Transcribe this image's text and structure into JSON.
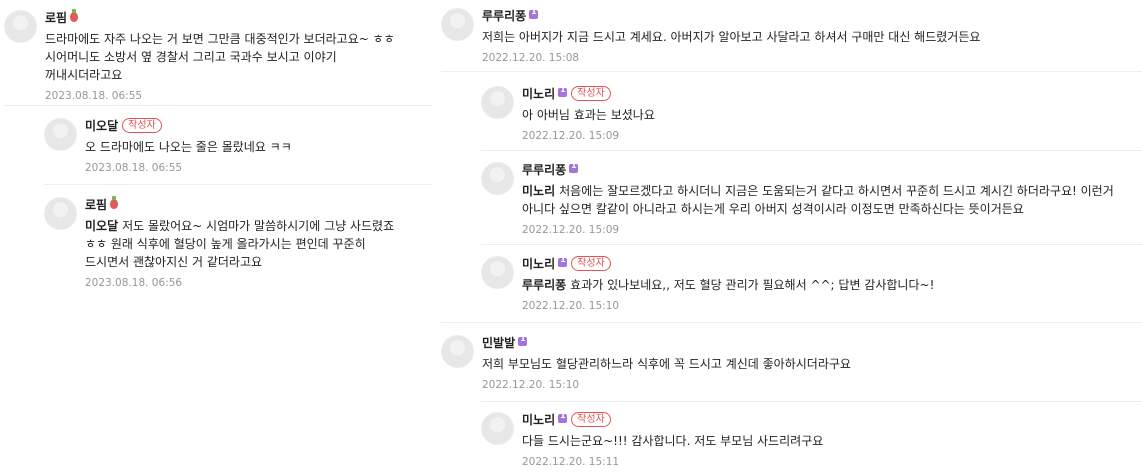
{
  "left": {
    "c1": {
      "nick": "로핌",
      "text": "드라마에도 자주 나오는 거 보면 그만큼 대중적인가 보더라고요~ ㅎㅎ 시어머니도 소방서 옆 경찰서 그리고 국과수 보시고 이야기 꺼내시더라고요",
      "date": "2023.08.18. 06:55"
    },
    "c2": {
      "nick": "미오달",
      "badge": "작성자",
      "text": "오 드라마에도 나오는 줄은 몰랐네요 ㅋㅋ",
      "date": "2023.08.18. 06:55"
    },
    "c3": {
      "nick": "로핌",
      "mention": "미오달",
      "text": "저도 몰랐어요~ 시엄마가 말씀하시기에 그냥 사드렸죠 ㅎㅎ 원래 식후에 혈당이 높게 올라가시는 편인데 꾸준히 드시면서 괜찮아지신 거 같더라고요",
      "date": "2023.08.18. 06:56"
    }
  },
  "right": {
    "c1": {
      "nick": "루루리퐁",
      "text": "저희는 아버지가 지금 드시고 계세요. 아버지가 알아보고 사달라고 하셔서 구매만 대신 해드렸거든요",
      "date": "2022.12.20. 15:08"
    },
    "c2": {
      "nick": "미노리",
      "badge": "작성자",
      "text": "아 아버님 효과는 보셨나요",
      "date": "2022.12.20. 15:09"
    },
    "c3": {
      "nick": "루루리퐁",
      "mention": "미노리",
      "text": "처음에는 잘모르겠다고 하시더니 지금은 도움되는거 같다고 하시면서 꾸준히 드시고 계시긴 하더라구요! 이런거 아니다 싶으면 칼같이 아니라고 하시는게 우리 아버지 성격이시라 이정도면 만족하신다는 뜻이거든요",
      "date": "2022.12.20. 15:09"
    },
    "c4": {
      "nick": "미노리",
      "badge": "작성자",
      "mention": "루루리퐁",
      "text": "효과가 있나보네요,, 저도 혈당 관리가 필요해서 ^^; 답변 감사합니다~!",
      "date": "2022.12.20. 15:10"
    },
    "c5": {
      "nick": "민발발",
      "text": "저희 부모님도 혈당관리하느라 식후에 꼭 드시고 계신데 좋아하시더라구요",
      "date": "2022.12.20. 15:10"
    },
    "c6": {
      "nick": "미노리",
      "badge": "작성자",
      "text": "다들 드시는군요~!!! 감사합니다. 저도 부모님 사드리려구요",
      "date": "2022.12.20. 15:11"
    }
  }
}
